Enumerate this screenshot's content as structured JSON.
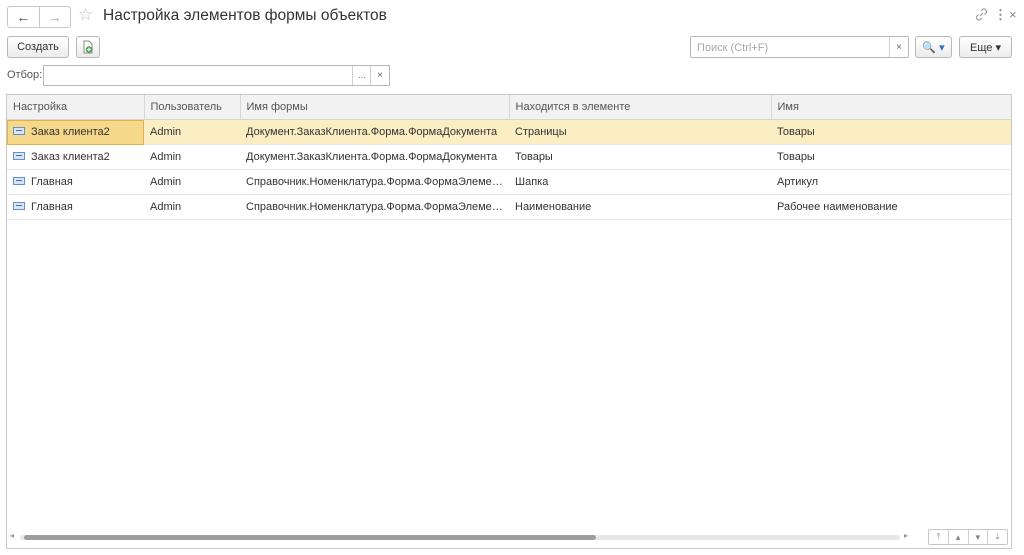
{
  "window": {
    "title": "Настройка элементов формы объектов",
    "back_icon": "←",
    "forward_icon": "→",
    "star_icon": "☆",
    "link_icon": "🔗",
    "menu_icon": "⋮",
    "close_icon": "×"
  },
  "toolbar": {
    "create_label": "Создать",
    "search_placeholder": "Поиск (Ctrl+F)",
    "search_clear": "×",
    "search_button": "🔍 ▾",
    "more_label": "Еще ▾"
  },
  "filter": {
    "label": "Отбор:",
    "value": "",
    "ellipsis": "...",
    "clear": "×"
  },
  "table": {
    "columns": [
      "Настройка",
      "Пользователь",
      "Имя формы",
      "Находится в элементе",
      "Имя"
    ],
    "rows": [
      [
        "Заказ клиента2",
        "Admin",
        "Документ.ЗаказКлиента.Форма.ФормаДокумента",
        "Страницы",
        "Товары"
      ],
      [
        "Заказ клиента2",
        "Admin",
        "Документ.ЗаказКлиента.Форма.ФормаДокумента",
        "Товары",
        "Товары"
      ],
      [
        "Главная",
        "Admin",
        "Справочник.Номенклатура.Форма.ФормаЭлемента",
        "Шапка",
        "Артикул"
      ],
      [
        "Главная",
        "Admin",
        "Справочник.Номенклатура.Форма.ФормаЭлемента",
        "Наименование",
        "Рабочее наименование"
      ]
    ],
    "selected_row": 0
  },
  "scroll": {
    "left_arrow": "◂",
    "right_arrow": "▸",
    "first_icon": "⤒",
    "up_icon": "▲",
    "down_icon": "▼",
    "last_icon": "⤓"
  },
  "colors": {
    "selected_row": "#fbeec2",
    "current_cell": "#f6d88a",
    "add_icon": "#3aa545"
  }
}
